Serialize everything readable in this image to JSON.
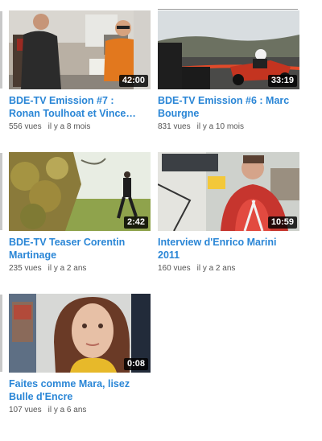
{
  "videos": [
    {
      "title": "BDE-TV Emission #7 :\nRonan Toulhoat et Vince…",
      "duration": "42:00",
      "views": "556 vues",
      "age": "il y a 8 mois"
    },
    {
      "title": "BDE-TV Emission #6 : Marc\nBourgne",
      "duration": "33:19",
      "views": "831 vues",
      "age": "il y a 10 mois"
    },
    {
      "title": "BDE-TV Teaser Corentin\nMartinage",
      "duration": "2:42",
      "views": "235 vues",
      "age": "il y a 2 ans"
    },
    {
      "title": "Interview d'Enrico Marini\n2011",
      "duration": "10:59",
      "views": "160 vues",
      "age": "il y a 2 ans"
    },
    {
      "title": "Faites comme Mara, lisez\nBulle d'Encre",
      "duration": "0:08",
      "views": "107 vues",
      "age": "il y a 6 ans"
    }
  ]
}
